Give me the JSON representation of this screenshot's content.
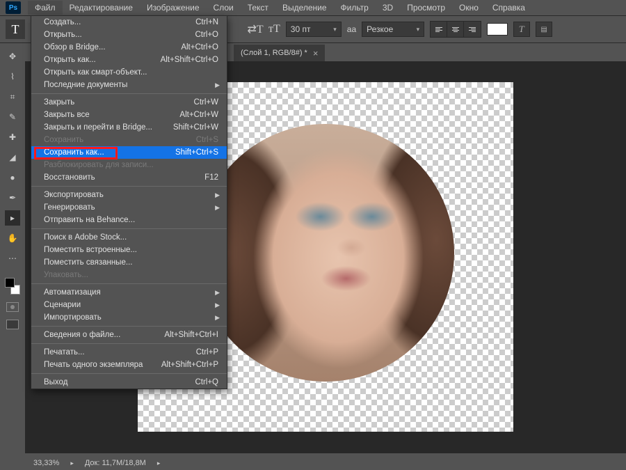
{
  "app": {
    "logo": "Ps"
  },
  "menubar": [
    "Файл",
    "Редактирование",
    "Изображение",
    "Слои",
    "Текст",
    "Выделение",
    "Фильтр",
    "3D",
    "Просмотр",
    "Окно",
    "Справка"
  ],
  "active_menu_index": 0,
  "options_bar": {
    "font_size": "30 пт",
    "aa_label": "aа",
    "aa_value": "Резкое",
    "orientation_icon": "T"
  },
  "tab": {
    "title": "(Слой 1, RGB/8#) *"
  },
  "dropdown": [
    {
      "type": "item",
      "label": "Создать...",
      "shortcut": "Ctrl+N"
    },
    {
      "type": "item",
      "label": "Открыть...",
      "shortcut": "Ctrl+O"
    },
    {
      "type": "item",
      "label": "Обзор в Bridge...",
      "shortcut": "Alt+Ctrl+O"
    },
    {
      "type": "item",
      "label": "Открыть как...",
      "shortcut": "Alt+Shift+Ctrl+O"
    },
    {
      "type": "item",
      "label": "Открыть как смарт-объект..."
    },
    {
      "type": "submenu",
      "label": "Последние документы"
    },
    {
      "type": "sep"
    },
    {
      "type": "item",
      "label": "Закрыть",
      "shortcut": "Ctrl+W"
    },
    {
      "type": "item",
      "label": "Закрыть все",
      "shortcut": "Alt+Ctrl+W"
    },
    {
      "type": "item",
      "label": "Закрыть и перейти в Bridge...",
      "shortcut": "Shift+Ctrl+W"
    },
    {
      "type": "item",
      "label": "Сохранить",
      "shortcut": "Ctrl+S",
      "disabled": true
    },
    {
      "type": "item",
      "label": "Сохранить как...",
      "shortcut": "Shift+Ctrl+S",
      "highlighted": true
    },
    {
      "type": "item",
      "label": "Разблокировать для записи...",
      "disabled": true
    },
    {
      "type": "item",
      "label": "Восстановить",
      "shortcut": "F12"
    },
    {
      "type": "sep"
    },
    {
      "type": "submenu",
      "label": "Экспортировать"
    },
    {
      "type": "submenu",
      "label": "Генерировать"
    },
    {
      "type": "item",
      "label": "Отправить на Behance..."
    },
    {
      "type": "sep"
    },
    {
      "type": "item",
      "label": "Поиск в Adobe Stock..."
    },
    {
      "type": "item",
      "label": "Поместить встроенные..."
    },
    {
      "type": "item",
      "label": "Поместить связанные..."
    },
    {
      "type": "item",
      "label": "Упаковать...",
      "disabled": true
    },
    {
      "type": "sep"
    },
    {
      "type": "submenu",
      "label": "Автоматизация"
    },
    {
      "type": "submenu",
      "label": "Сценарии"
    },
    {
      "type": "submenu",
      "label": "Импортировать"
    },
    {
      "type": "sep"
    },
    {
      "type": "item",
      "label": "Сведения о файле...",
      "shortcut": "Alt+Shift+Ctrl+I"
    },
    {
      "type": "sep"
    },
    {
      "type": "item",
      "label": "Печатать...",
      "shortcut": "Ctrl+P"
    },
    {
      "type": "item",
      "label": "Печать одного экземпляра",
      "shortcut": "Alt+Shift+Ctrl+P"
    },
    {
      "type": "sep"
    },
    {
      "type": "item",
      "label": "Выход",
      "shortcut": "Ctrl+Q"
    }
  ],
  "status": {
    "zoom": "33,33%",
    "doc_info": "Док: 11,7M/18,8M"
  }
}
